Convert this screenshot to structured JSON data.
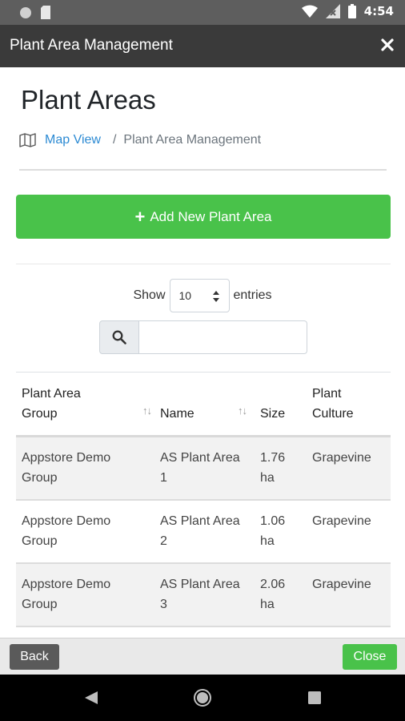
{
  "status_bar": {
    "time": "4:54"
  },
  "modal": {
    "title": "Plant Area Management"
  },
  "page": {
    "title": "Plant Areas"
  },
  "breadcrumb": {
    "link": "Map View",
    "separator": "/",
    "current": "Plant Area Management"
  },
  "actions": {
    "add_label": "Add New Plant Area"
  },
  "length_menu": {
    "show": "Show",
    "value": "10",
    "entries": "entries"
  },
  "search": {
    "value": ""
  },
  "table": {
    "headers": {
      "group_line1": "Plant Area",
      "group_line2": "Group",
      "name": "Name",
      "size": "Size",
      "culture_line1": "Plant",
      "culture_line2": "Culture"
    },
    "rows": [
      {
        "group_line1": "Appstore Demo",
        "group_line2": "Group",
        "name_line1": "AS Plant Area",
        "name_line2": "1",
        "size_line1": "1.76",
        "size_line2": "ha",
        "culture": "Grapevine"
      },
      {
        "group_line1": "Appstore Demo",
        "group_line2": "Group",
        "name_line1": "AS Plant Area",
        "name_line2": "2",
        "size_line1": "1.06",
        "size_line2": "ha",
        "culture": "Grapevine"
      },
      {
        "group_line1": "Appstore Demo",
        "group_line2": "Group",
        "name_line1": "AS Plant Area",
        "name_line2": "3",
        "size_line1": "2.06",
        "size_line2": "ha",
        "culture": "Grapevine"
      }
    ]
  },
  "footer": {
    "back": "Back",
    "close": "Close"
  },
  "colors": {
    "primary_green": "#49c24a",
    "link_blue": "#2c8ad3",
    "header_dark": "#3a3a3a"
  }
}
